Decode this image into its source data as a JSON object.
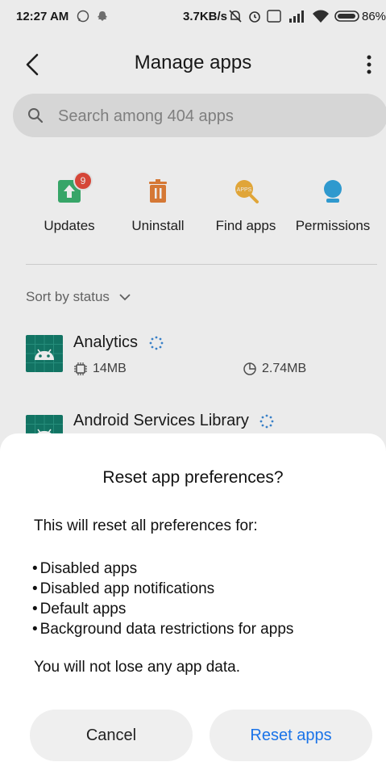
{
  "status_bar": {
    "time": "12:27 AM",
    "speed": "3.7KB/s",
    "battery": "86%"
  },
  "header": {
    "title": "Manage apps"
  },
  "search": {
    "placeholder": "Search among 404 apps"
  },
  "quick_actions": [
    {
      "label": "Updates",
      "icon": "update-icon",
      "badge": "9",
      "color": "#3cb371"
    },
    {
      "label": "Uninstall",
      "icon": "trash-icon",
      "color": "#e8833a"
    },
    {
      "label": "Find apps",
      "icon": "find-apps-icon",
      "color": "#f3b33d"
    },
    {
      "label": "Permissions",
      "icon": "permissions-icon",
      "color": "#34a6e0"
    }
  ],
  "sort": {
    "label": "Sort by status"
  },
  "apps": [
    {
      "name": "Analytics",
      "storage": "14MB",
      "data": "2.74MB"
    },
    {
      "name": "Android Services Library"
    }
  ],
  "dialog": {
    "title": "Reset app preferences?",
    "message": "This will reset all preferences for:",
    "items": [
      "Disabled apps",
      "Disabled app notifications",
      "Default apps",
      "Background data restrictions for apps"
    ],
    "note": "You will not lose any app data.",
    "cancel_label": "Cancel",
    "reset_label": "Reset apps"
  },
  "colors": {
    "accent": "#1a73e8",
    "app_icon_bg": "#147d6c"
  }
}
